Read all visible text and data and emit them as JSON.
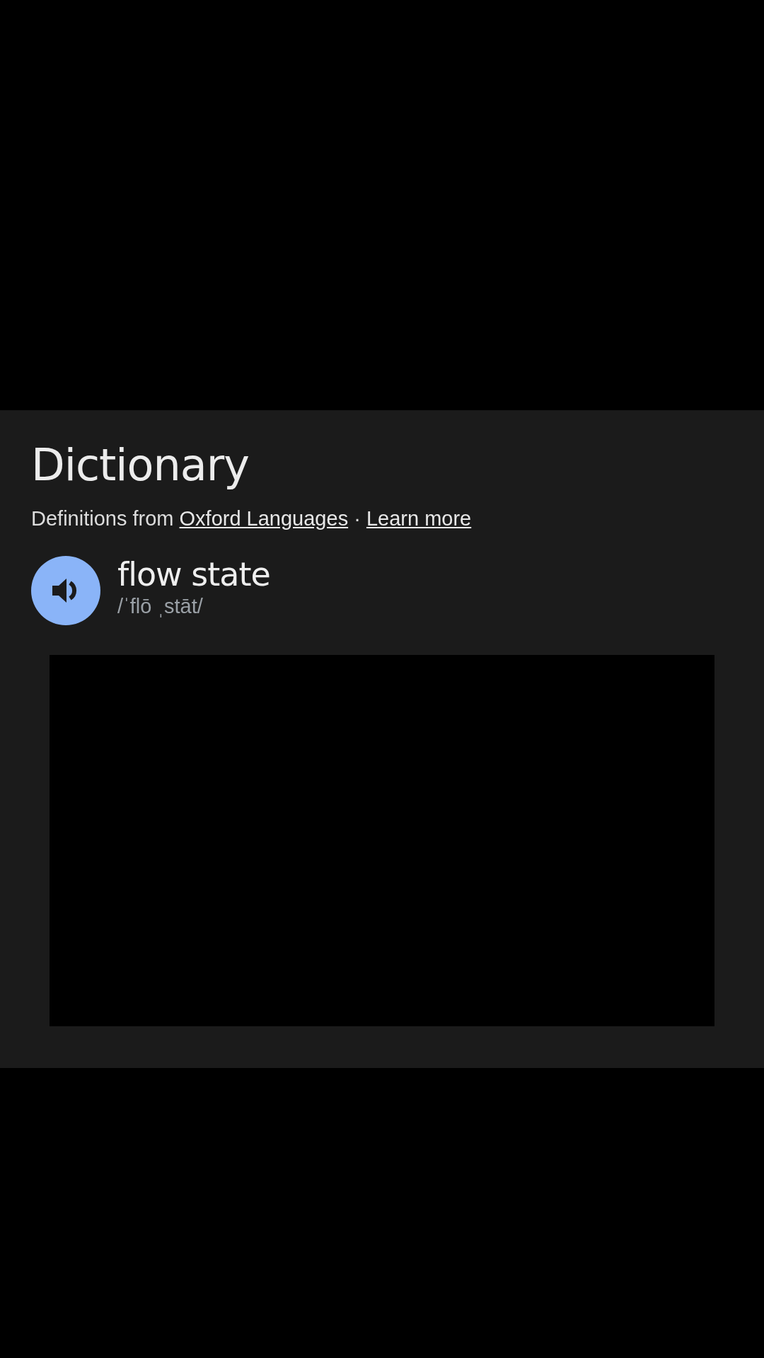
{
  "dictionary": {
    "heading": "Dictionary",
    "attribution": {
      "prefix": "Definitions from",
      "source_link": "Oxford Languages",
      "separator": "·",
      "learn_more_link": "Learn more"
    },
    "entry": {
      "word": "flow state",
      "pronunciation": "/ˈflō ˌstāt/"
    }
  }
}
